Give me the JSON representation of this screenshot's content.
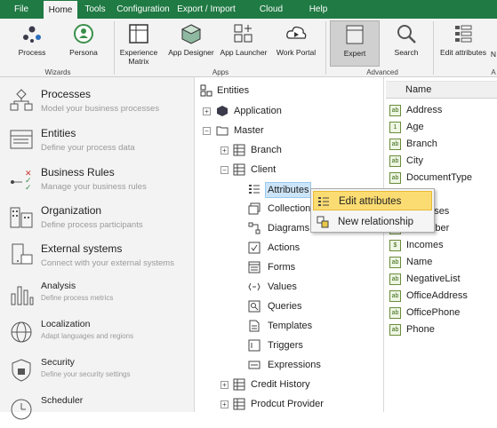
{
  "menubar": {
    "items": [
      "File",
      "Home",
      "Tools",
      "Configuration",
      "Export / Import",
      "Cloud Services",
      "Help"
    ],
    "active": "Home"
  },
  "ribbon": {
    "buttons": {
      "process": "Process",
      "persona": "Persona",
      "experience_matrix_1": "Experience",
      "experience_matrix_2": "Matrix",
      "app_designer": "App Designer",
      "app_launcher": "App Launcher",
      "work_portal": "Work Portal",
      "expert": "Expert",
      "search": "Search",
      "edit_attributes": "Edit attributes",
      "truncated": "N"
    },
    "groups": {
      "wizards": "Wizards",
      "apps": "Apps",
      "advanced": "Advanced",
      "truncated": "A"
    }
  },
  "left_panel": {
    "items": [
      {
        "title": "Processes",
        "subtitle": "Model your business processes",
        "icon": "processes-icon"
      },
      {
        "title": "Entities",
        "subtitle": "Define your process data",
        "icon": "entities-icon"
      },
      {
        "title": "Business Rules",
        "subtitle": "Manage your business rules",
        "icon": "business-rules-icon"
      },
      {
        "title": "Organization",
        "subtitle": "Define process participants",
        "icon": "organization-icon"
      },
      {
        "title": "External systems",
        "subtitle": "Connect with your external systems",
        "icon": "external-systems-icon"
      },
      {
        "title": "Analysis",
        "subtitle": "Define process metrics",
        "icon": "analysis-icon"
      },
      {
        "title": "Localization",
        "subtitle": "Adapt languages and regions",
        "icon": "localization-icon"
      },
      {
        "title": "Security",
        "subtitle": "Define your security settings",
        "icon": "security-icon"
      },
      {
        "title": "Scheduler",
        "subtitle": "",
        "icon": "scheduler-icon"
      }
    ]
  },
  "tree": {
    "root": "Entities",
    "application": "Application",
    "master": "Master",
    "branch": "Branch",
    "client": "Client",
    "client_children": [
      "Attributes",
      "Collections",
      "Diagrams",
      "Actions",
      "Forms",
      "Values",
      "Queries",
      "Templates",
      "Triggers",
      "Expressions"
    ],
    "credit_history": "Credit History",
    "product_provider": "Prodcut Provider"
  },
  "attributes_list": {
    "header": "Name",
    "rows": [
      {
        "name": "Address",
        "type": "ab"
      },
      {
        "name": "Age",
        "type": "1"
      },
      {
        "name": "Branch",
        "type": "ab"
      },
      {
        "name": "City",
        "type": "ab"
      },
      {
        "name": "DocumentType",
        "type": "ab"
      },
      {
        "name": "",
        "type": "ab"
      },
      {
        "name": "Expenses",
        "type": "ab"
      },
      {
        "name": "IdNumber",
        "type": "ab"
      },
      {
        "name": "Incomes",
        "type": "$"
      },
      {
        "name": "Name",
        "type": "ab"
      },
      {
        "name": "NegativeList",
        "type": "ab"
      },
      {
        "name": "OfficeAddress",
        "type": "ab"
      },
      {
        "name": "OfficePhone",
        "type": "ab"
      },
      {
        "name": "Phone",
        "type": "ab"
      }
    ]
  },
  "context_menu": {
    "items": [
      "Edit attributes",
      "New relationship"
    ]
  },
  "colors": {
    "accent": "#1f7a43",
    "highlight": "#fbdc72",
    "selection": "#cce4f7"
  }
}
